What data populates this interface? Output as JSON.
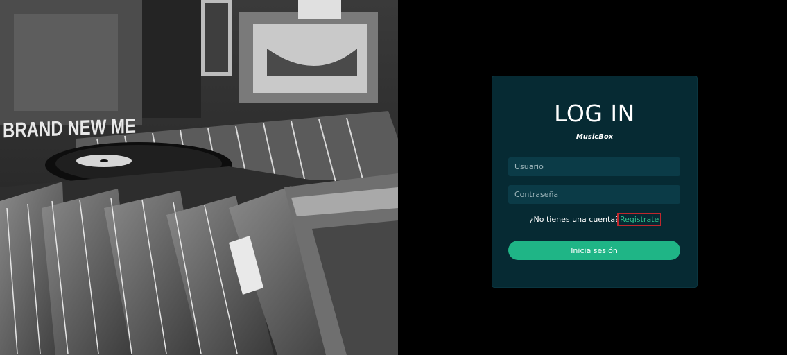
{
  "login": {
    "title": "LOG IN",
    "brand": "MusicBox",
    "username_placeholder": "Usuario",
    "password_placeholder": "Contraseña",
    "no_account_text": "¿No tienes una cuenta?",
    "register_link": "Registrate",
    "submit_label": "Inicia sesión"
  },
  "hero": {
    "sign_text": "BRAND NEW ME"
  },
  "colors": {
    "card_bg": "#062a33",
    "input_bg": "#0b3b47",
    "accent": "#1fb586",
    "link": "#2fbf8c",
    "highlight": "#c0272d"
  }
}
